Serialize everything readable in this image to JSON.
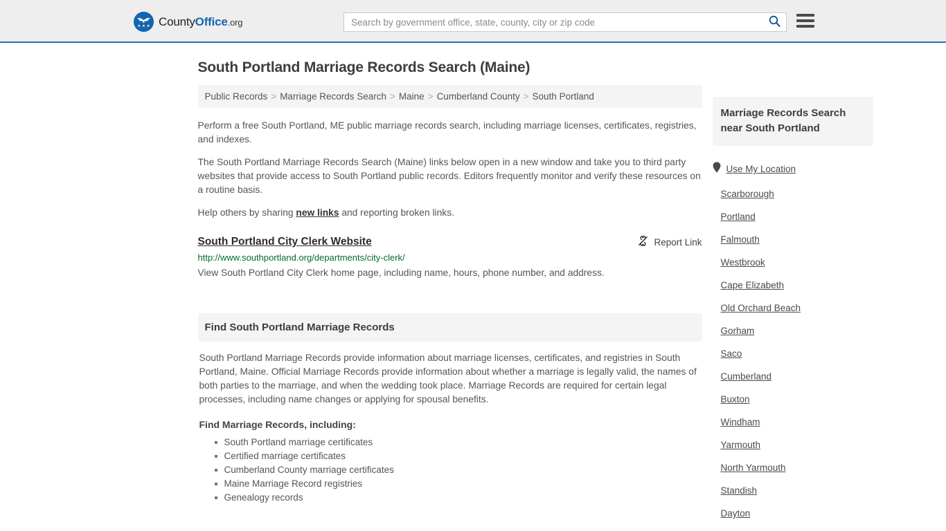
{
  "header": {
    "brand": {
      "county": "County",
      "office": "Office",
      "org": ".org",
      "icon": "eagle-stars-logo"
    },
    "search": {
      "placeholder": "Search by government office, state, county, city or zip code",
      "value": "",
      "icon": "search-icon"
    },
    "menu_icon": "hamburger-menu-icon",
    "accent_color": "#2d70b3"
  },
  "main": {
    "title": "South Portland Marriage Records Search (Maine)",
    "breadcrumb": [
      "Public Records",
      "Marriage Records Search",
      "Maine",
      "Cumberland County",
      "South Portland"
    ],
    "breadcrumb_separator": ">",
    "paragraphs": [
      "Perform a free South Portland, ME public marriage records search, including marriage licenses, certificates, registries, and indexes.",
      "The South Portland Marriage Records Search (Maine) links below open in a new window and take you to third party websites that provide access to South Portland public records. Editors frequently monitor and verify these resources on a routine basis."
    ],
    "share_line": {
      "before": "Help others by sharing ",
      "link": "new links",
      "after": " and reporting broken links."
    },
    "result": {
      "title": "South Portland City Clerk Website",
      "report_label": "Report Link",
      "report_icon": "broken-link-icon",
      "url": "http://www.southportland.org/departments/city-clerk/",
      "url_color": "#046b2e",
      "description": "View South Portland City Clerk home page, including name, hours, phone number, and address."
    },
    "section": {
      "heading": "Find South Portland Marriage Records",
      "paragraph": "South Portland Marriage Records provide information about marriage licenses, certificates, and registries in South Portland, Maine. Official Marriage Records provide information about whether a marriage is legally valid, the names of both parties to the marriage, and when the wedding took place. Marriage Records are required for certain legal processes, including name changes or applying for spousal benefits.",
      "list_heading": "Find Marriage Records, including:",
      "list": [
        "South Portland marriage certificates",
        "Certified marriage certificates",
        "Cumberland County marriage certificates",
        "Maine Marriage Record registries",
        "Genealogy records"
      ]
    }
  },
  "sidebar": {
    "heading": "Marriage Records Search near South Portland",
    "use_location": {
      "label": "Use My Location",
      "icon": "map-pin-icon"
    },
    "cities": [
      "Scarborough",
      "Portland",
      "Falmouth",
      "Westbrook",
      "Cape Elizabeth",
      "Old Orchard Beach",
      "Gorham",
      "Saco",
      "Cumberland",
      "Buxton",
      "Windham",
      "Yarmouth",
      "North Yarmouth",
      "Standish",
      "Dayton"
    ]
  }
}
